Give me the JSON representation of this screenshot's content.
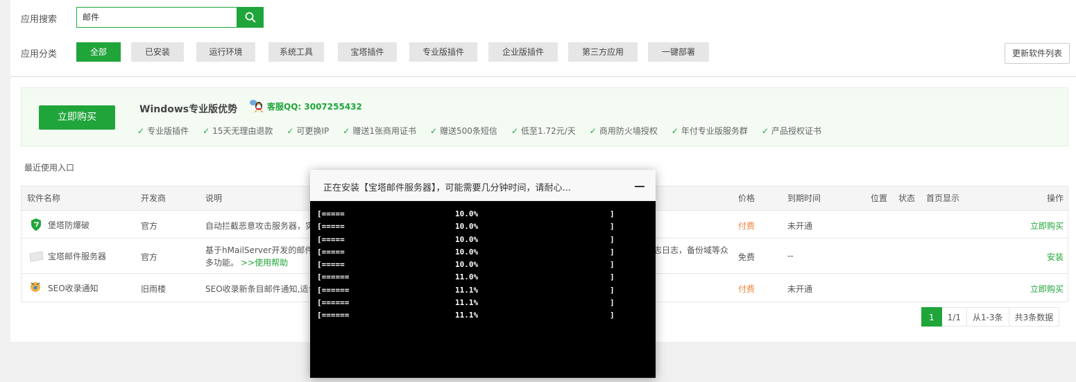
{
  "search": {
    "label": "应用搜索",
    "value": "邮件"
  },
  "category": {
    "label": "应用分类",
    "items": [
      "全部",
      "已安装",
      "运行环境",
      "系统工具",
      "宝塔插件",
      "专业版插件",
      "企业版插件",
      "第三方应用",
      "一键部署"
    ],
    "active": "全部"
  },
  "refresh_label": "更新软件列表",
  "promo": {
    "buy_label": "立即购买",
    "title": "Windows专业版优势",
    "qq": "客服QQ: 3007255432",
    "features": [
      "专业版插件",
      "15天无理由退款",
      "可更换IP",
      "赠送1张商用证书",
      "赠送500条短信",
      "低至1.72元/天",
      "商用防火墙授权",
      "年付专业版服务群",
      "产品授权证书"
    ]
  },
  "recent_label": "最近使用入口",
  "table": {
    "headers": {
      "name": "软件名称",
      "dev": "开发商",
      "desc": "说明",
      "price": "价格",
      "expire": "到期时间",
      "location": "位置",
      "status": "状态",
      "home": "首页显示",
      "action": "操作"
    },
    "rows": [
      {
        "name": "堡塔防爆破",
        "dev": "官方",
        "desc": "自动拦截恶意攻击服务器，实",
        "desc_right": "",
        "help": "",
        "price": "付费",
        "expire": "未开通",
        "action": "立即购买"
      },
      {
        "name": "宝塔邮件服务器",
        "dev": "官方",
        "desc": "基于hMailServer开发的邮件",
        "desc2": "多功能。",
        "help": ">>使用帮助",
        "desc_right": "志日志，备份域等众",
        "price": "免费",
        "expire": "--",
        "action": "安装"
      },
      {
        "name": "SEO收录通知",
        "dev": "旧雨楼",
        "desc": "SEO收录新条目邮件通知,适合",
        "desc_right": "",
        "help": "",
        "price": "付费",
        "expire": "未开通",
        "action": "立即购买"
      }
    ]
  },
  "pager": {
    "current": "1",
    "pages": "1/1",
    "range": "从1-3条",
    "total": "共3条数据"
  },
  "modal": {
    "title": "正在安装【宝塔邮件服务器】，可能需要几分钟时间，请耐心...",
    "lines": [
      {
        "bar": "[=====",
        "pct": "10.0%",
        "end": "]"
      },
      {
        "bar": "[=====",
        "pct": "10.0%",
        "end": "]"
      },
      {
        "bar": "[=====",
        "pct": "10.0%",
        "end": "]"
      },
      {
        "bar": "[=====",
        "pct": "10.0%",
        "end": "]"
      },
      {
        "bar": "[=====",
        "pct": "10.0%",
        "end": "]"
      },
      {
        "bar": "[======",
        "pct": "11.0%",
        "end": "]"
      },
      {
        "bar": "[======",
        "pct": "11.1%",
        "end": "]"
      },
      {
        "bar": "[======",
        "pct": "11.1%",
        "end": "]"
      },
      {
        "bar": "[======",
        "pct": "11.1%",
        "end": "]"
      }
    ]
  },
  "colors": {
    "accent": "#20a53a",
    "paid": "#f0843c"
  }
}
